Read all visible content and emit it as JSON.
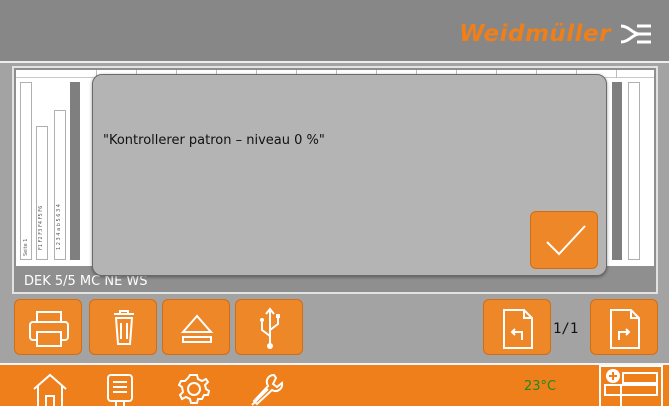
{
  "header": {
    "brand": "Weidmüller",
    "brand_color": "#ee7f1a",
    "logo_icon": "weidmuller-logo-icon"
  },
  "workspace": {
    "strip_text_1": "Seite 1",
    "strip_text_2": "F1 F2 F3 F4 F5 F6",
    "strip_text_3": "1 2 3 4 a b 5 6 3 4",
    "product_label": "DEK 5/5 MC NE WS"
  },
  "dialog": {
    "message": "\"Kontrollerer patron – niveau 0 %\"",
    "confirm_icon": "checkmark-icon"
  },
  "toolbar": {
    "buttons": [
      {
        "name": "print-button",
        "icon": "printer-icon"
      },
      {
        "name": "delete-button",
        "icon": "trash-icon"
      },
      {
        "name": "eject-button",
        "icon": "eject-icon"
      },
      {
        "name": "usb-button",
        "icon": "usb-icon"
      },
      {
        "name": "previous-page-button",
        "icon": "page-back-icon"
      },
      {
        "name": "next-page-button",
        "icon": "page-forward-icon"
      }
    ],
    "page_indicator": "1/1"
  },
  "navbar": {
    "items": [
      {
        "name": "nav-home",
        "icon": "home-icon"
      },
      {
        "name": "nav-printer-queue",
        "icon": "printer-list-icon"
      },
      {
        "name": "nav-settings",
        "icon": "gear-icon"
      },
      {
        "name": "nav-tools",
        "icon": "wrench-icon"
      }
    ],
    "temperature": "23°C",
    "temperature_color": "#1f8a1f"
  },
  "colors": {
    "accent": "#ee8728",
    "background": "#a3a3a3",
    "dialog": "#b4b4b4"
  }
}
